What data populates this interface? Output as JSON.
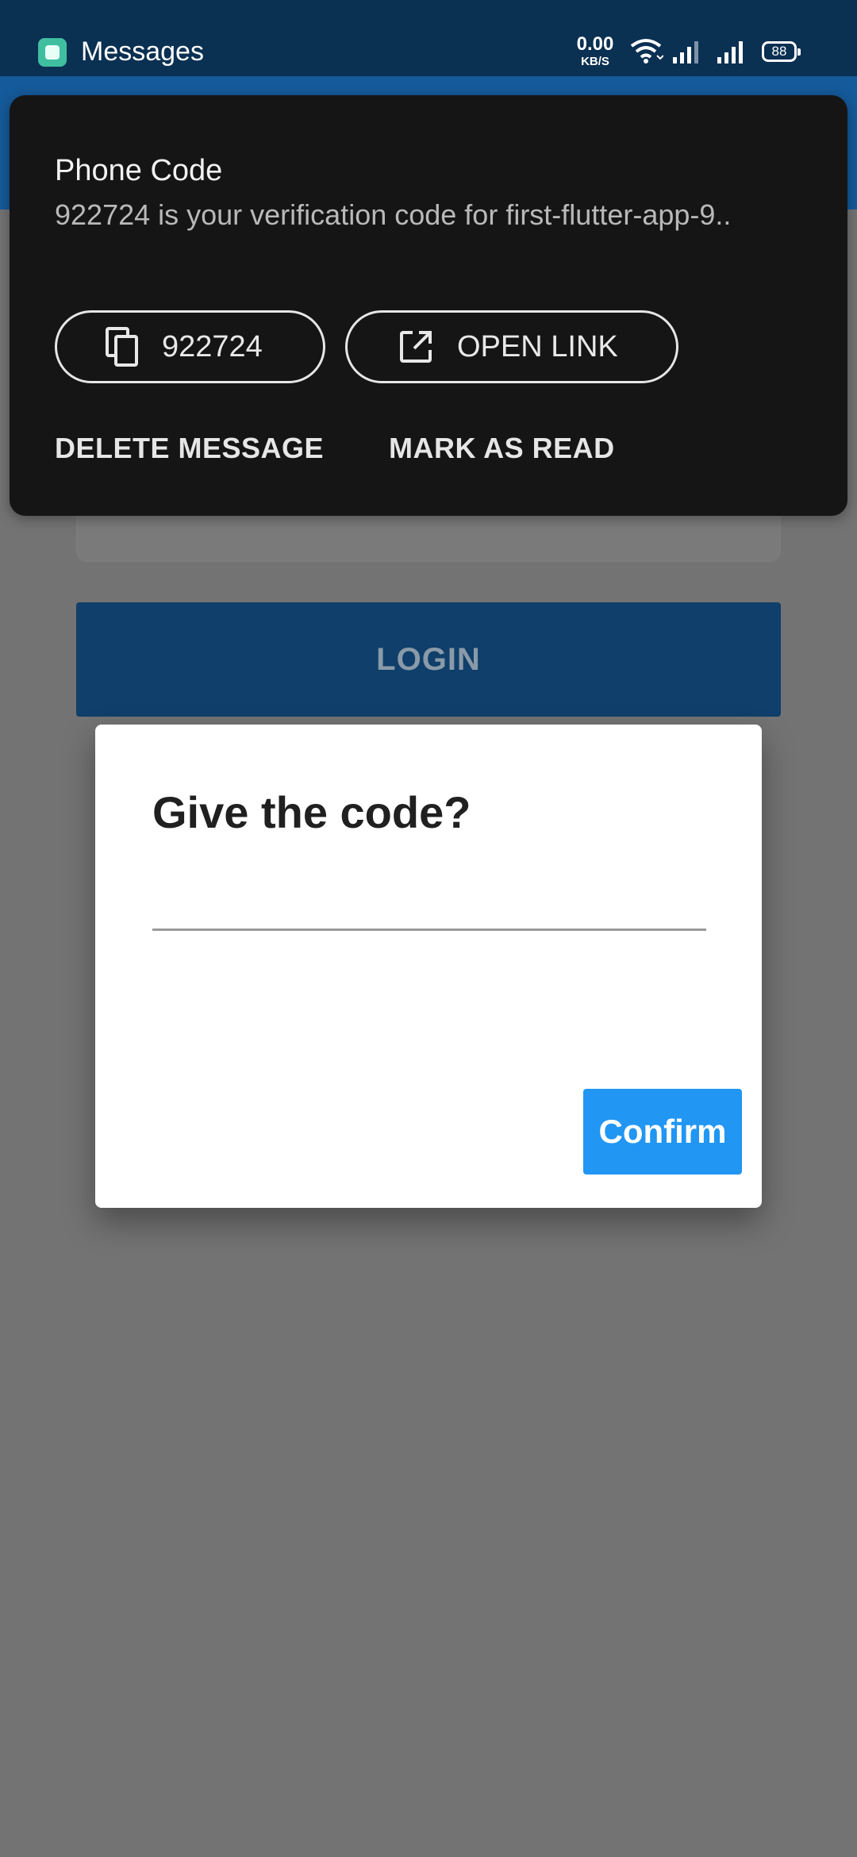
{
  "status_bar": {
    "app_name": "Messages",
    "net_speed_value": "0.00",
    "net_speed_unit": "KB/S",
    "battery_level": "88"
  },
  "notification": {
    "title": "Phone Code",
    "body": "922724 is your verification code for first-flutter-app-9..",
    "copy_chip_label": "922724",
    "open_link_label": "OPEN LINK",
    "delete_label": "DELETE MESSAGE",
    "mark_read_label": "MARK AS READ"
  },
  "background": {
    "login_label": "LOGIN"
  },
  "dialog": {
    "title": "Give the code?",
    "input_value": "",
    "confirm_label": "Confirm"
  },
  "colors": {
    "status_bar": "#0a3052",
    "app_bar": "#155a9a",
    "scrim_background": "#737373",
    "notification_background": "#151515",
    "confirm_button": "#2196f3"
  },
  "icons": [
    "messages-app-icon",
    "wifi-icon",
    "signal-icon",
    "battery-icon",
    "copy-icon",
    "open-link-icon"
  ]
}
